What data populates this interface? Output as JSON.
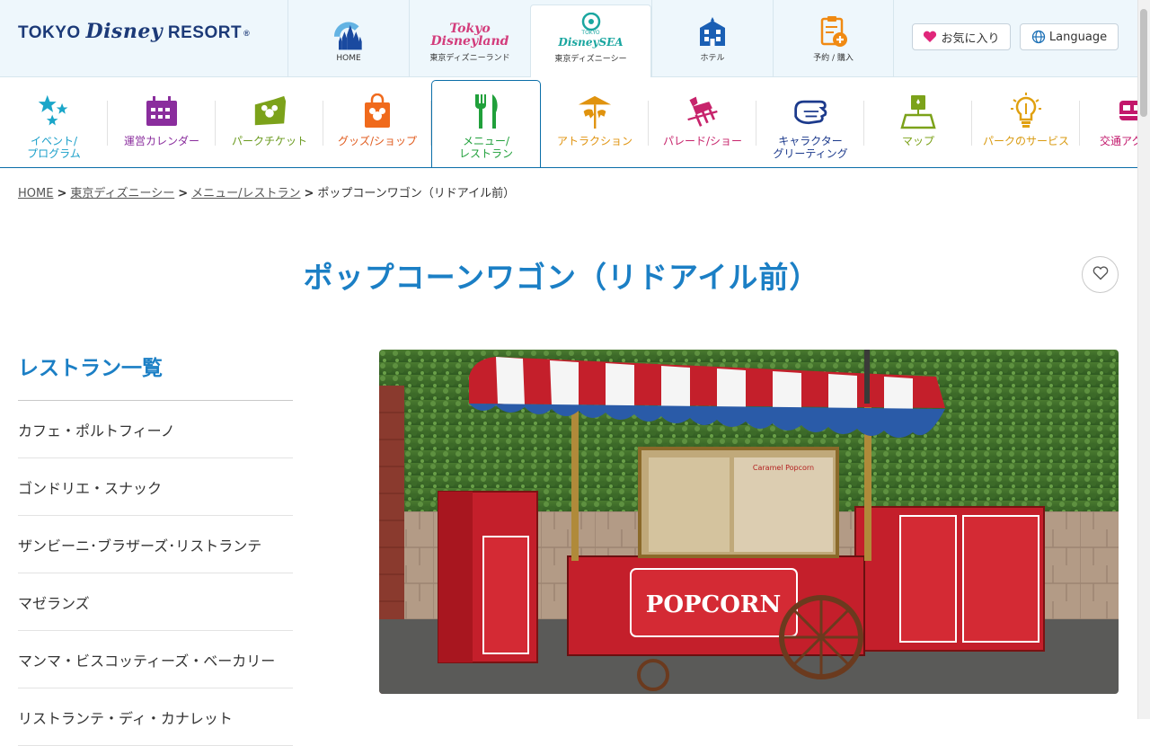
{
  "header": {
    "logo": {
      "part1": "TOKYO ",
      "part2": "Disney",
      "part3": " RESORT",
      "reg": "®"
    },
    "park_tabs": [
      {
        "id": "home",
        "label": "HOME"
      },
      {
        "id": "tdl",
        "brand": "Tokyo Disneyland",
        "label": "東京ディズニーランド"
      },
      {
        "id": "tds",
        "brand": "DisneySEA",
        "brand_small": "TOKYO",
        "label": "東京ディズニーシー"
      },
      {
        "id": "hotel",
        "label": "ホテル"
      },
      {
        "id": "reserve",
        "label": "予約 / 購入"
      }
    ],
    "favorites_label": "お気に入り",
    "language_label": "Language"
  },
  "category_nav": [
    {
      "id": "event",
      "label": "イベント/\nプログラム",
      "color": "#1a9fc9",
      "icon": "stars-icon"
    },
    {
      "id": "calendar",
      "label": "運営カレンダー",
      "color": "#8a2d9d",
      "icon": "calendar-icon"
    },
    {
      "id": "ticket",
      "label": "パークチケット",
      "color": "#6a9a1e",
      "icon": "ticket-icon"
    },
    {
      "id": "goods",
      "label": "グッズ/ショップ",
      "color": "#e05a1c",
      "icon": "shopping-bag-icon"
    },
    {
      "id": "menu",
      "label": "メニュー/\nレストラン",
      "color": "#20a03b",
      "icon": "fork-knife-icon"
    },
    {
      "id": "attraction",
      "label": "アトラクション",
      "color": "#e0930e",
      "icon": "carousel-icon"
    },
    {
      "id": "parade",
      "label": "パレード/ショー",
      "color": "#c7236b",
      "icon": "parade-icon"
    },
    {
      "id": "greeting",
      "label": "キャラクター\nグリーティング",
      "color": "#1c3a8c",
      "icon": "glove-icon"
    },
    {
      "id": "map",
      "label": "マップ",
      "color": "#7ca21a",
      "icon": "map-icon"
    },
    {
      "id": "service",
      "label": "パークのサービス",
      "color": "#d99a10",
      "icon": "lightbulb-icon"
    },
    {
      "id": "transport",
      "label": "交通アク",
      "color": "#c2176b",
      "icon": "monorail-icon"
    }
  ],
  "breadcrumb": {
    "items": [
      "HOME",
      "東京ディズニーシー",
      "メニュー/レストラン"
    ],
    "current": "ポップコーンワゴン（リドアイル前）",
    "separator": ">"
  },
  "page": {
    "title": "ポップコーンワゴン（リドアイル前）"
  },
  "sidebar": {
    "title": "レストラン一覧",
    "items": [
      "カフェ・ポルトフィーノ",
      "ゴンドリエ・スナック",
      "ザンビーニ･ブラザーズ･リストランテ",
      "マゼランズ",
      "マンマ・ビスコッティーズ・ベーカリー",
      "リストランテ・ディ・カナレット"
    ]
  },
  "photo": {
    "sign_text": "POPCORN",
    "small_sign": "Caramel Popcorn"
  },
  "colors": {
    "accent_blue": "#1b7fc5",
    "nav_border": "#0a6ea8"
  }
}
